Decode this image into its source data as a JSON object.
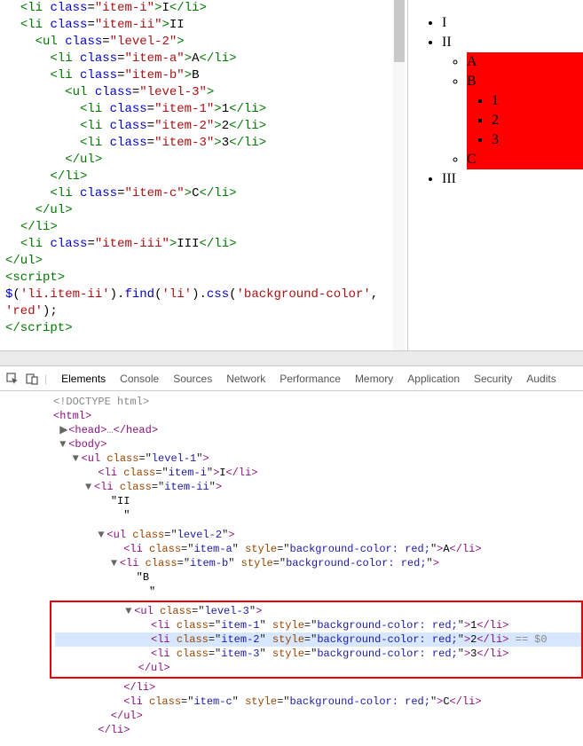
{
  "code": {
    "l1": "<li class=\"item-i\">I</li>",
    "l2": "<li class=\"item-ii\">II",
    "l3": "  <ul class=\"level-2\">",
    "l4": "    <li class=\"item-a\">A</li>",
    "l5": "    <li class=\"item-b\">B",
    "l6": "      <ul class=\"level-3\">",
    "l7": "        <li class=\"item-1\">1</li>",
    "l8": "        <li class=\"item-2\">2</li>",
    "l9": "        <li class=\"item-3\">3</li>",
    "l10": "      </ul>",
    "l11": "    </li>",
    "l12": "    <li class=\"item-c\">C</li>",
    "l13": "  </ul>",
    "l14": "</li>",
    "l15": "<li class=\"item-iii\">III</li>",
    "l16": "</ul>",
    "l17": "<script>",
    "l18": "$('li.item-ii').find('li').css('background-color', 'red');",
    "l19": "</script>"
  },
  "preview": {
    "i": "I",
    "ii": "II",
    "iii": "III",
    "a": "A",
    "b": "B",
    "c": "C",
    "n1": "1",
    "n2": "2",
    "n3": "3"
  },
  "devtools": {
    "tabs": [
      "Elements",
      "Console",
      "Sources",
      "Network",
      "Performance",
      "Memory",
      "Application",
      "Security",
      "Audits"
    ],
    "doctype": "<!DOCTYPE html>",
    "html": "<html>",
    "head": "<head>…</head>",
    "body": "<body>",
    "ul1": "<ul class=\"level-1\">",
    "li_i": "<li class=\"item-i\">I</li>",
    "li_ii": "<li class=\"item-ii\">",
    "txt_ii": "\"II\n\"",
    "ul2": "<ul class=\"level-2\">",
    "li_a": "<li class=\"item-a\" style=\"background-color: red;\">A</li>",
    "li_b": "<li class=\"item-b\" style=\"background-color: red;\">",
    "txt_b": "\"B\n\"",
    "ul3": "<ul class=\"level-3\">",
    "li_1": "<li class=\"item-1\" style=\"background-color: red;\">1</li>",
    "li_2": "<li class=\"item-2\" style=\"background-color: red;\">2</li>",
    "li_3": "<li class=\"item-3\" style=\"background-color: red;\">3</li>",
    "ul3_close": "</ul>",
    "li_close": "</li>",
    "li_c": "<li class=\"item-c\" style=\"background-color: red;\">C</li>",
    "ul2_close": "</ul>",
    "sel_suffix": " == $0"
  }
}
